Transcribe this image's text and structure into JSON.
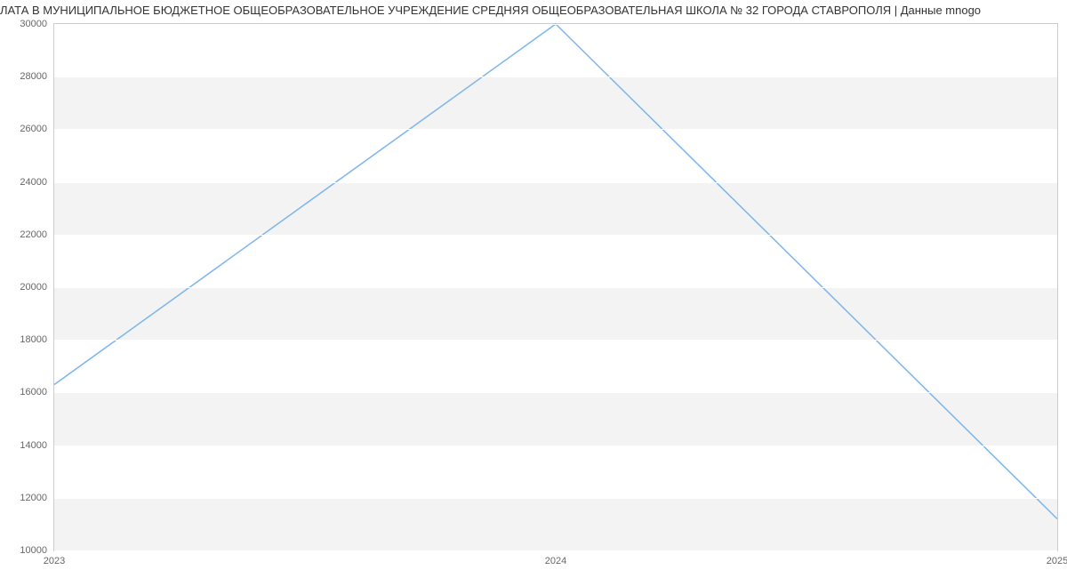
{
  "chart_data": {
    "type": "line",
    "title": "ЛАТА В МУНИЦИПАЛЬНОЕ БЮДЖЕТНОЕ ОБЩЕОБРАЗОВАТЕЛЬНОЕ УЧРЕЖДЕНИЕ СРЕДНЯЯ ОБЩЕОБРАЗОВАТЕЛЬНАЯ ШКОЛА № 32 ГОРОДА СТАВРОПОЛЯ | Данные mnogo",
    "x": [
      2023,
      2024,
      2025
    ],
    "values": [
      16300,
      30000,
      11200
    ],
    "xlabel": "",
    "ylabel": "",
    "xlim": [
      2023,
      2025
    ],
    "ylim": [
      10000,
      30000
    ],
    "y_ticks": [
      10000,
      12000,
      14000,
      16000,
      18000,
      20000,
      22000,
      24000,
      26000,
      28000,
      30000
    ],
    "x_ticks": [
      2023,
      2024,
      2025
    ],
    "line_color": "#7cb5ec"
  }
}
